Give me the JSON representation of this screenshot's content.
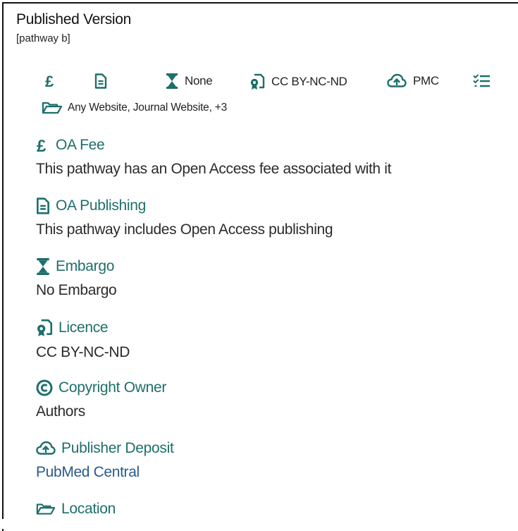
{
  "header": {
    "title": "Published Version",
    "subtitle": "[pathway b]"
  },
  "iconbar": {
    "fee_icon": "pound-icon",
    "publishing_icon": "document-icon",
    "embargo": {
      "icon": "hourglass-icon",
      "label": "None"
    },
    "licence": {
      "icon": "licence-icon",
      "label": "CC BY-NC-ND"
    },
    "deposit": {
      "icon": "cloud-upload-icon",
      "label": "PMC"
    },
    "conditions_icon": "checklist-icon",
    "location": {
      "icon": "folder-open-icon",
      "label": "Any Website, Journal Website, +3"
    }
  },
  "sections": {
    "fee": {
      "icon": "pound-icon",
      "title": "OA Fee",
      "desc": "This pathway has an Open Access fee associated with it"
    },
    "publishing": {
      "icon": "document-icon",
      "title": "OA Publishing",
      "desc": "This pathway includes Open Access publishing"
    },
    "embargo": {
      "icon": "hourglass-icon",
      "title": "Embargo",
      "desc": "No Embargo"
    },
    "licence": {
      "icon": "licence-icon",
      "title": "Licence",
      "desc": "CC BY-NC-ND"
    },
    "copyright": {
      "icon": "copyright-icon",
      "title": "Copyright Owner",
      "desc": "Authors"
    },
    "deposit": {
      "icon": "cloud-upload-icon",
      "title": "Publisher Deposit",
      "desc": "PubMed Central"
    },
    "location": {
      "icon": "folder-open-icon",
      "title": "Location"
    }
  },
  "colors": {
    "teal": "#1d6f6a",
    "link": "#2a5a88",
    "text": "#2b2b2b"
  }
}
